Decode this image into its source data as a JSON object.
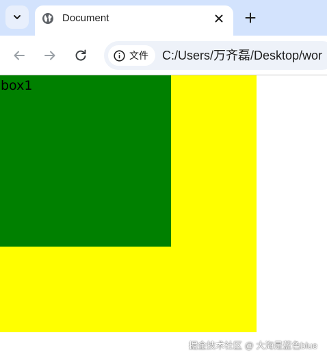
{
  "tab": {
    "title": "Document",
    "favicon": "globe-icon"
  },
  "toolbar": {
    "site_chip_label": "文件",
    "url": "C:/Users/万齐磊/Desktop/wor"
  },
  "page": {
    "box1_text": "box1"
  },
  "colors": {
    "box1": "#008000",
    "box2": "#ffff00",
    "tabstrip": "#d3e3fd"
  },
  "watermark": {
    "text": "掘金技术社区 @ 大海是蓝色blue"
  }
}
